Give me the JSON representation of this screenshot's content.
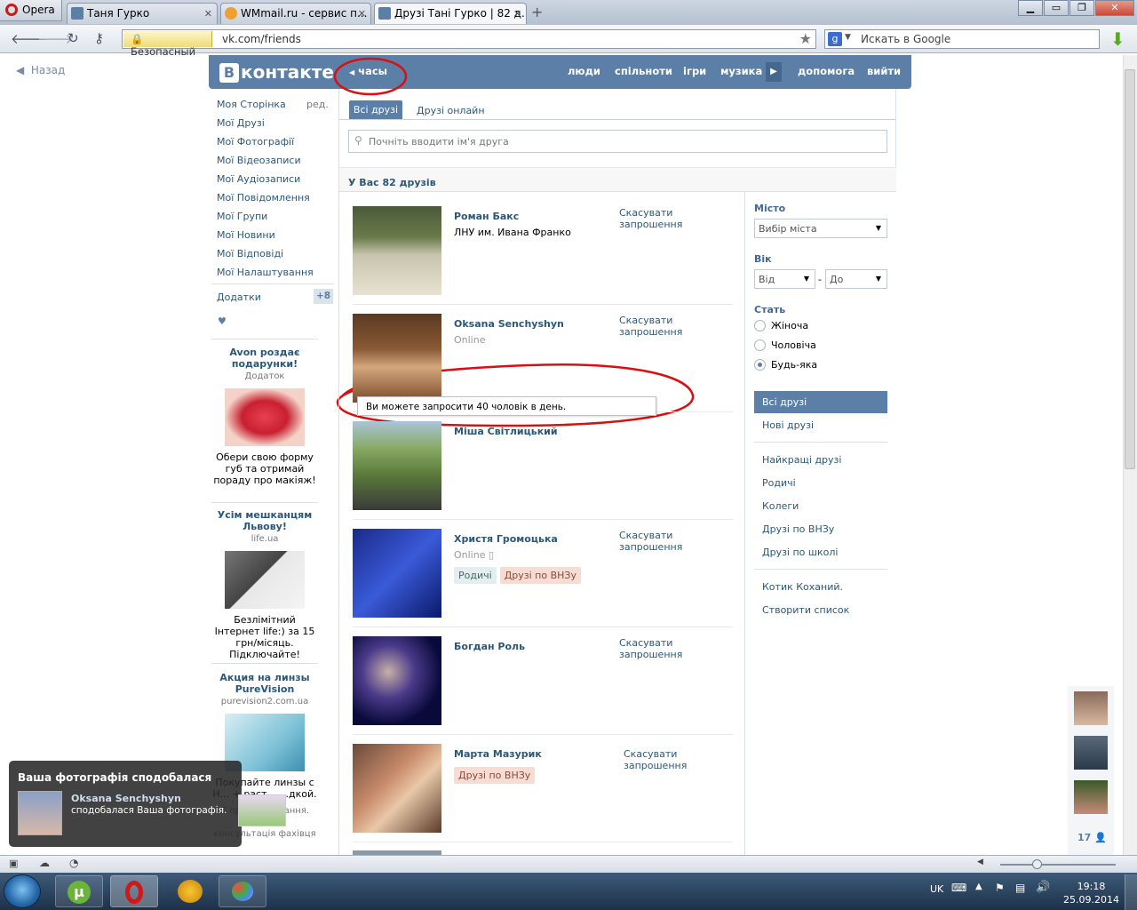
{
  "browser": {
    "menu_label": "Opera",
    "tabs": [
      {
        "label": "Таня Гурко",
        "icon": "vk-favicon"
      },
      {
        "label": "WMmail.ru - сервис п...",
        "icon": "wmmail-favicon"
      },
      {
        "label": "Друзі Тані Гурко | 82 д...",
        "icon": "vk-favicon"
      }
    ],
    "secure_label": "Безопасный",
    "url": "vk.com/friends",
    "search_placeholder": "Искать в Google"
  },
  "page": {
    "back_label": "Назад",
    "logo_text": "контакте",
    "logo_letter": "В",
    "clock_label": "часы",
    "nav": [
      "люди",
      "спільноти",
      "ігри",
      "музика",
      "допомога",
      "вийти"
    ],
    "left_menu": [
      "Моя Сторінка",
      "Мої Друзі",
      "Мої Фотографії",
      "Мої Відеозаписи",
      "Мої Аудіозаписи",
      "Мої Повідомлення",
      "Мої Групи",
      "Мої Новини",
      "Мої Відповіді",
      "Мої Налаштування"
    ],
    "edit_label": "ред.",
    "apps_label": "Додатки",
    "apps_count": "+8",
    "heart": "♥",
    "ads": [
      {
        "title": "Avon роздає подарунки!",
        "sub": "Додаток",
        "text": "Обери свою форму губ та отримай пораду про макіяж!"
      },
      {
        "title": "Усім мешканцям Львову!",
        "sub": "life.ua",
        "text": "Безлімітний Інтернет life:) за 15 грн/місяць. Підключайте!"
      },
      {
        "title": "Акция на линзы PureVision",
        "sub": "purevision2.com.ua",
        "text": "Покупайте линзы с Н... + раст... ...дкой."
      },
      {
        "text2": "Є протипоказання. Потрібна консультація фахівця"
      }
    ],
    "tabs": {
      "all": "Всі друзі",
      "online": "Друзі онлайн"
    },
    "find_placeholder": "Почніть вводити ім'я друга",
    "count_text": "У Вас 82 друзів",
    "friends": [
      {
        "name": "Роман Бакс",
        "sub": "ЛНУ им. Ивана Франко",
        "action": "Скасувати запрошення"
      },
      {
        "name": "Oksana Senchyshyn",
        "sub": "Online",
        "action": "Скасувати запрошення"
      },
      {
        "name": "Міша Світлицький",
        "sub": "",
        "action": ""
      },
      {
        "name": "Христя Громоцька",
        "sub": "Online",
        "action": "Скасувати запрошення",
        "tags": [
          "Родичі",
          "Друзі по ВНЗу"
        ]
      },
      {
        "name": "Богдан Роль",
        "sub": "",
        "action": "Скасувати запрошення"
      },
      {
        "name": "Марта Мазурик",
        "sub": "",
        "action": "Скасувати запрошення",
        "tags": [
          "Друзі по ВНЗу"
        ]
      }
    ],
    "tooltip": "Ви можете запросити 40 чоловік в день.",
    "filters": {
      "city_label": "Місто",
      "city_value": "Вибір міста",
      "age_label": "Вік",
      "age_from": "Від",
      "age_dash": "-",
      "age_to": "До",
      "sex_label": "Стать",
      "sex_options": [
        "Жіноча",
        "Чоловіча",
        "Будь-яка"
      ],
      "lists_selected": "Всі друзі",
      "lists": [
        "Нові друзі",
        "Найкращі друзі",
        "Родичі",
        "Колеги",
        "Друзі по ВНЗу",
        "Друзі по школі",
        "Котик Коханий.",
        "Створити список"
      ]
    },
    "online_count": "17",
    "notification": {
      "title": "Ваша фотографія сподобалася",
      "name": "Oksana Senchyshyn",
      "text": "сподобалася Ваша фотографія."
    }
  },
  "taskbar": {
    "lang": "UK",
    "time": "19:18",
    "date": "25.09.2014"
  },
  "colors": {
    "vk_blue": "#5b7fa6",
    "link": "#2b587a",
    "annotation_red": "#d81010"
  }
}
